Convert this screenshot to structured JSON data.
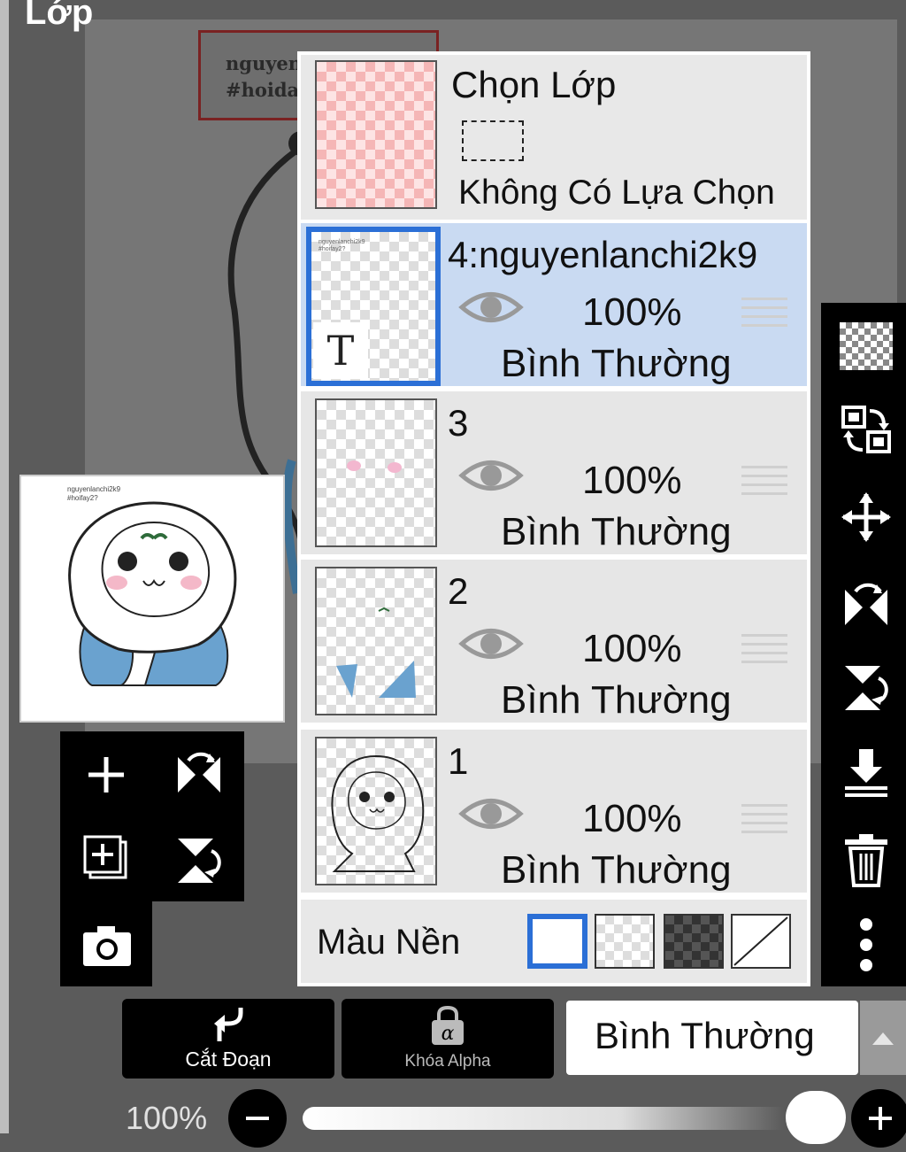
{
  "header": {
    "title": "Lớp"
  },
  "canvas_text": {
    "line1": "nguyen",
    "line2": "#hoida"
  },
  "preview": {
    "line1": "nguyenlanchi2k9",
    "line2": "#hoifay2?"
  },
  "selection": {
    "title": "Chọn Lớp",
    "status": "Không Có Lựa Chọn"
  },
  "layers": [
    {
      "name": "4:nguyenlanchi2k9",
      "opacity": "100%",
      "blend": "Bình Thường",
      "selected": true,
      "has_text": true,
      "thumb_text": "T"
    },
    {
      "name": "3",
      "opacity": "100%",
      "blend": "Bình Thường",
      "selected": false
    },
    {
      "name": "2",
      "opacity": "100%",
      "blend": "Bình Thường",
      "selected": false
    },
    {
      "name": "1",
      "opacity": "100%",
      "blend": "Bình Thường",
      "selected": false
    }
  ],
  "background_color": {
    "label": "Màu Nền",
    "options": [
      "white",
      "checker-light",
      "checker-dark",
      "none"
    ],
    "selected": "white"
  },
  "bottom": {
    "clip_label": "Cắt Đoạn",
    "alpha_lock_label": "Khóa Alpha",
    "blend_mode": "Bình Thường",
    "opacity": "100%",
    "opacity_value": 1.0
  },
  "right_toolbar": [
    "transparency-icon",
    "swap-icon",
    "move-icon",
    "flip-horizontal-icon",
    "flip-vertical-icon",
    "merge-down-icon",
    "trash-icon",
    "more-icon"
  ],
  "left_toolbar": [
    "add-layer-icon",
    "flip-horizontal-icon",
    "add-copy-icon",
    "flip-vertical-icon",
    "camera-icon"
  ],
  "colors": {
    "accent": "#2b6fd6",
    "selected_row": "#c9daf2",
    "row": "#e6e6e6"
  }
}
